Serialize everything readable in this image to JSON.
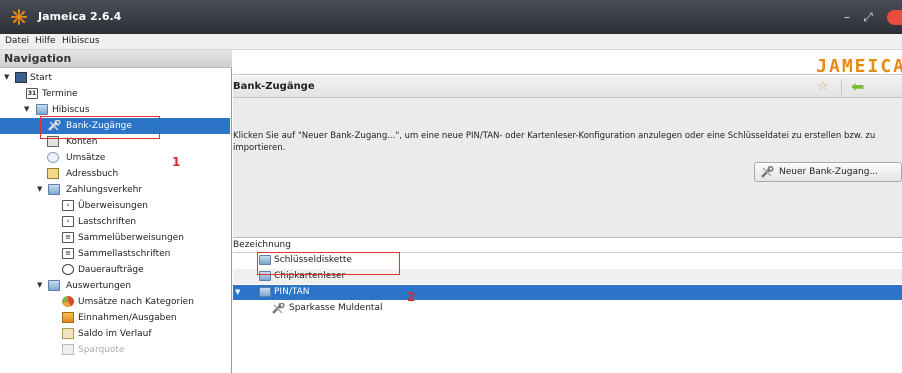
{
  "window": {
    "title": "Jameica 2.6.4"
  },
  "menu": {
    "items": [
      "Datei",
      "Hilfe",
      "Hibiscus"
    ]
  },
  "nav": {
    "header": "Navigation",
    "items": [
      {
        "label": "Start"
      },
      {
        "label": "Termine"
      },
      {
        "label": "Hibiscus"
      },
      {
        "label": "Bank-Zugänge"
      },
      {
        "label": "Konten"
      },
      {
        "label": "Umsätze"
      },
      {
        "label": "Adressbuch"
      },
      {
        "label": "Zahlungsverkehr"
      },
      {
        "label": "Überweisungen"
      },
      {
        "label": "Lastschriften"
      },
      {
        "label": "Sammelüberweisungen"
      },
      {
        "label": "Sammellastschriften"
      },
      {
        "label": "Daueraufträge"
      },
      {
        "label": "Auswertungen"
      },
      {
        "label": "Umsätze nach Kategorien"
      },
      {
        "label": "Einnahmen/Ausgaben"
      },
      {
        "label": "Saldo im Verlauf"
      },
      {
        "label": "Sparquote"
      }
    ],
    "termine_icon_text": "31"
  },
  "logo_text": "JAMEICA",
  "main": {
    "section_title": "Bank-Zugänge",
    "info_text": "Klicken Sie auf \"Neuer Bank-Zugang...\", um eine neue PIN/TAN- oder Kartenleser-Konfiguration anzulegen oder eine Schlüsseldatei zu erstellen bzw. zu importieren.",
    "new_button_label": "Neuer Bank-Zugang...",
    "table": {
      "column": "Bezeichnung",
      "rows": [
        {
          "label": "Schlüsseldiskette"
        },
        {
          "label": "Chipkartenleser"
        },
        {
          "label": "PIN/TAN"
        },
        {
          "label": "Sparkasse Muldental"
        }
      ]
    }
  },
  "annotations": {
    "marker_1": "1",
    "marker_2": "2"
  },
  "colors": {
    "selection": "#2b74c7",
    "annotation": "#e03434",
    "logo": "#e88a13"
  }
}
